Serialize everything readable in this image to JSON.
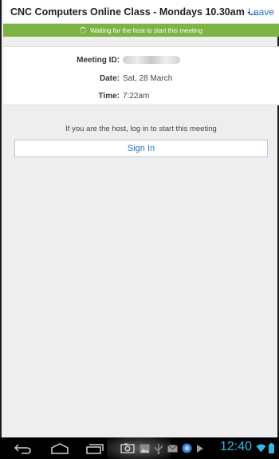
{
  "header": {
    "title": "CNC Computers Online Class - Mondays 10.30am -...",
    "leave_label": "Leave"
  },
  "status": {
    "waiting_text": "Waiting for the host to start this meeting"
  },
  "meeting": {
    "id_label": "Meeting ID:",
    "date_label": "Date:",
    "date_value": "Sat, 28 March",
    "time_label": "Time:",
    "time_value": "7:22am"
  },
  "host": {
    "message": "If you are the host, log in to start this meeting",
    "signin_label": "Sign In"
  },
  "system_bar": {
    "clock": "12:40",
    "icons": [
      "back-icon",
      "home-icon",
      "recent-apps-icon",
      "screenshot-icon",
      "gallery-icon",
      "usb-icon",
      "mail-icon",
      "app-icon",
      "play-icon",
      "wifi-icon",
      "battery-icon"
    ]
  },
  "colors": {
    "accent": "#2b73d0",
    "status_green": "#7cb342",
    "clock_blue": "#33b5e5"
  }
}
